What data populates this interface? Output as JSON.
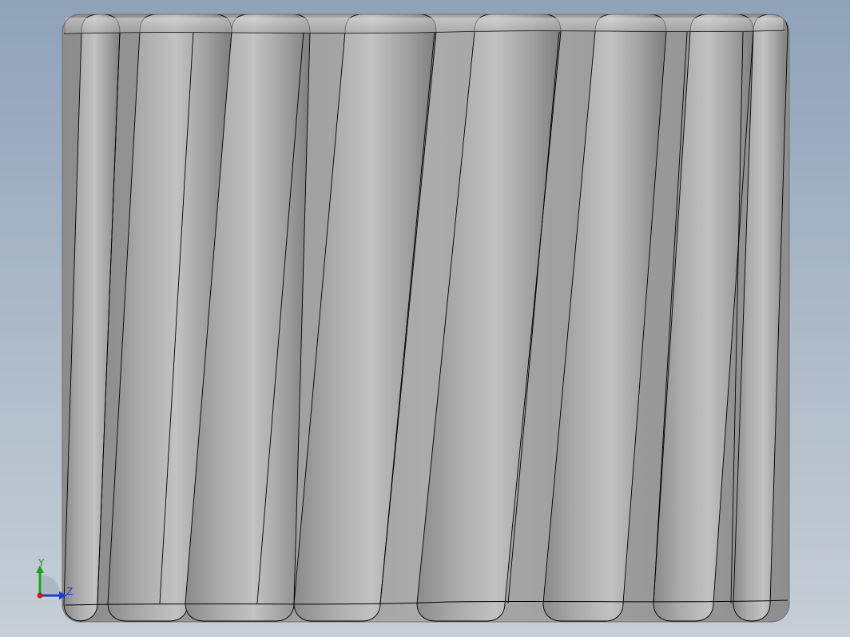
{
  "viewport": {
    "background_top": "#8fa2b8",
    "background_bottom": "#c6ced7"
  },
  "model": {
    "name": "helical-gear-body",
    "shading_dark": "#7c7c7c",
    "shading_mid": "#a6a6a6",
    "shading_light": "#c4c4c4",
    "edge_color": "#000000"
  },
  "triad": {
    "y_label": "Y",
    "z_label": "Z",
    "y_color": "#1aa31a",
    "z_color": "#1a3fd1",
    "origin_color": "#d11a1a"
  }
}
